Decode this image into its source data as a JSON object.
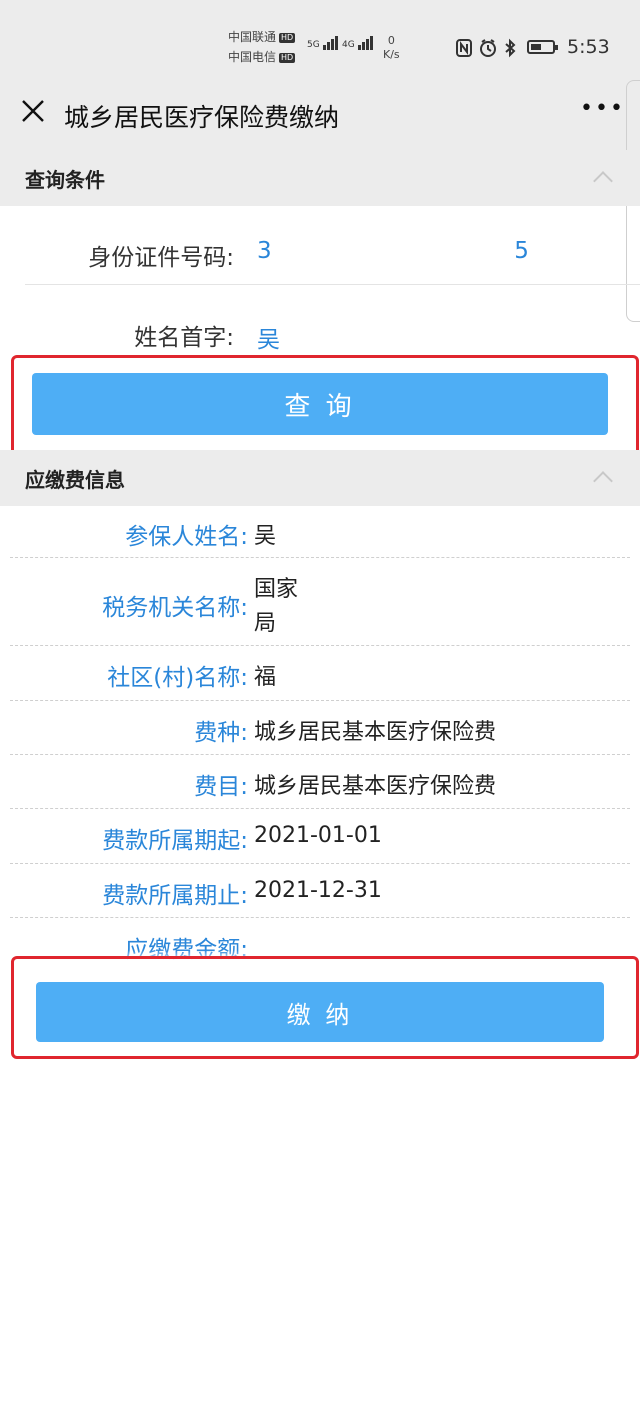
{
  "status_bar": {
    "carrier1": "中国联通",
    "carrier2": "中国电信",
    "hd_badge": "HD",
    "net1": "5G",
    "net2": "4G",
    "speed_value": "0",
    "speed_unit": "K/s",
    "time": "5:53",
    "icons": [
      "nfc-icon",
      "alarm-icon",
      "bluetooth-icon",
      "battery-icon"
    ]
  },
  "nav": {
    "title": "城乡居民医疗保险费缴纳",
    "close_icon": "close-icon",
    "more_icon": "more-icon",
    "more_glyph": "•••"
  },
  "query_section": {
    "title": "查询条件",
    "id_label": "身份证件号码:",
    "id_value_start": "3",
    "id_value_end": "5",
    "name_label": "姓名首字:",
    "name_value": "吴",
    "query_button": "查  询"
  },
  "info_section": {
    "title": "应缴费信息",
    "rows": [
      {
        "label": "参保人姓名:",
        "value": "吴"
      },
      {
        "label": "税务机关名称:",
        "value": "国家",
        "value2": "局"
      },
      {
        "label": "社区(村)名称:",
        "value": "福"
      },
      {
        "label": "费种:",
        "value": "城乡居民基本医疗保险费"
      },
      {
        "label": "费目:",
        "value": "城乡居民基本医疗保险费"
      },
      {
        "label": "费款所属期起:",
        "value": "2021-01-01"
      },
      {
        "label": "费款所属期止:",
        "value": "2021-12-31"
      },
      {
        "label": "应缴费金额:",
        "value": ""
      }
    ],
    "pay_button": "缴  纳"
  },
  "colors": {
    "accent_blue": "#4eaef5",
    "link_blue": "#2a86d9",
    "highlight_red": "#e0262e",
    "header_gray": "#ececec"
  }
}
